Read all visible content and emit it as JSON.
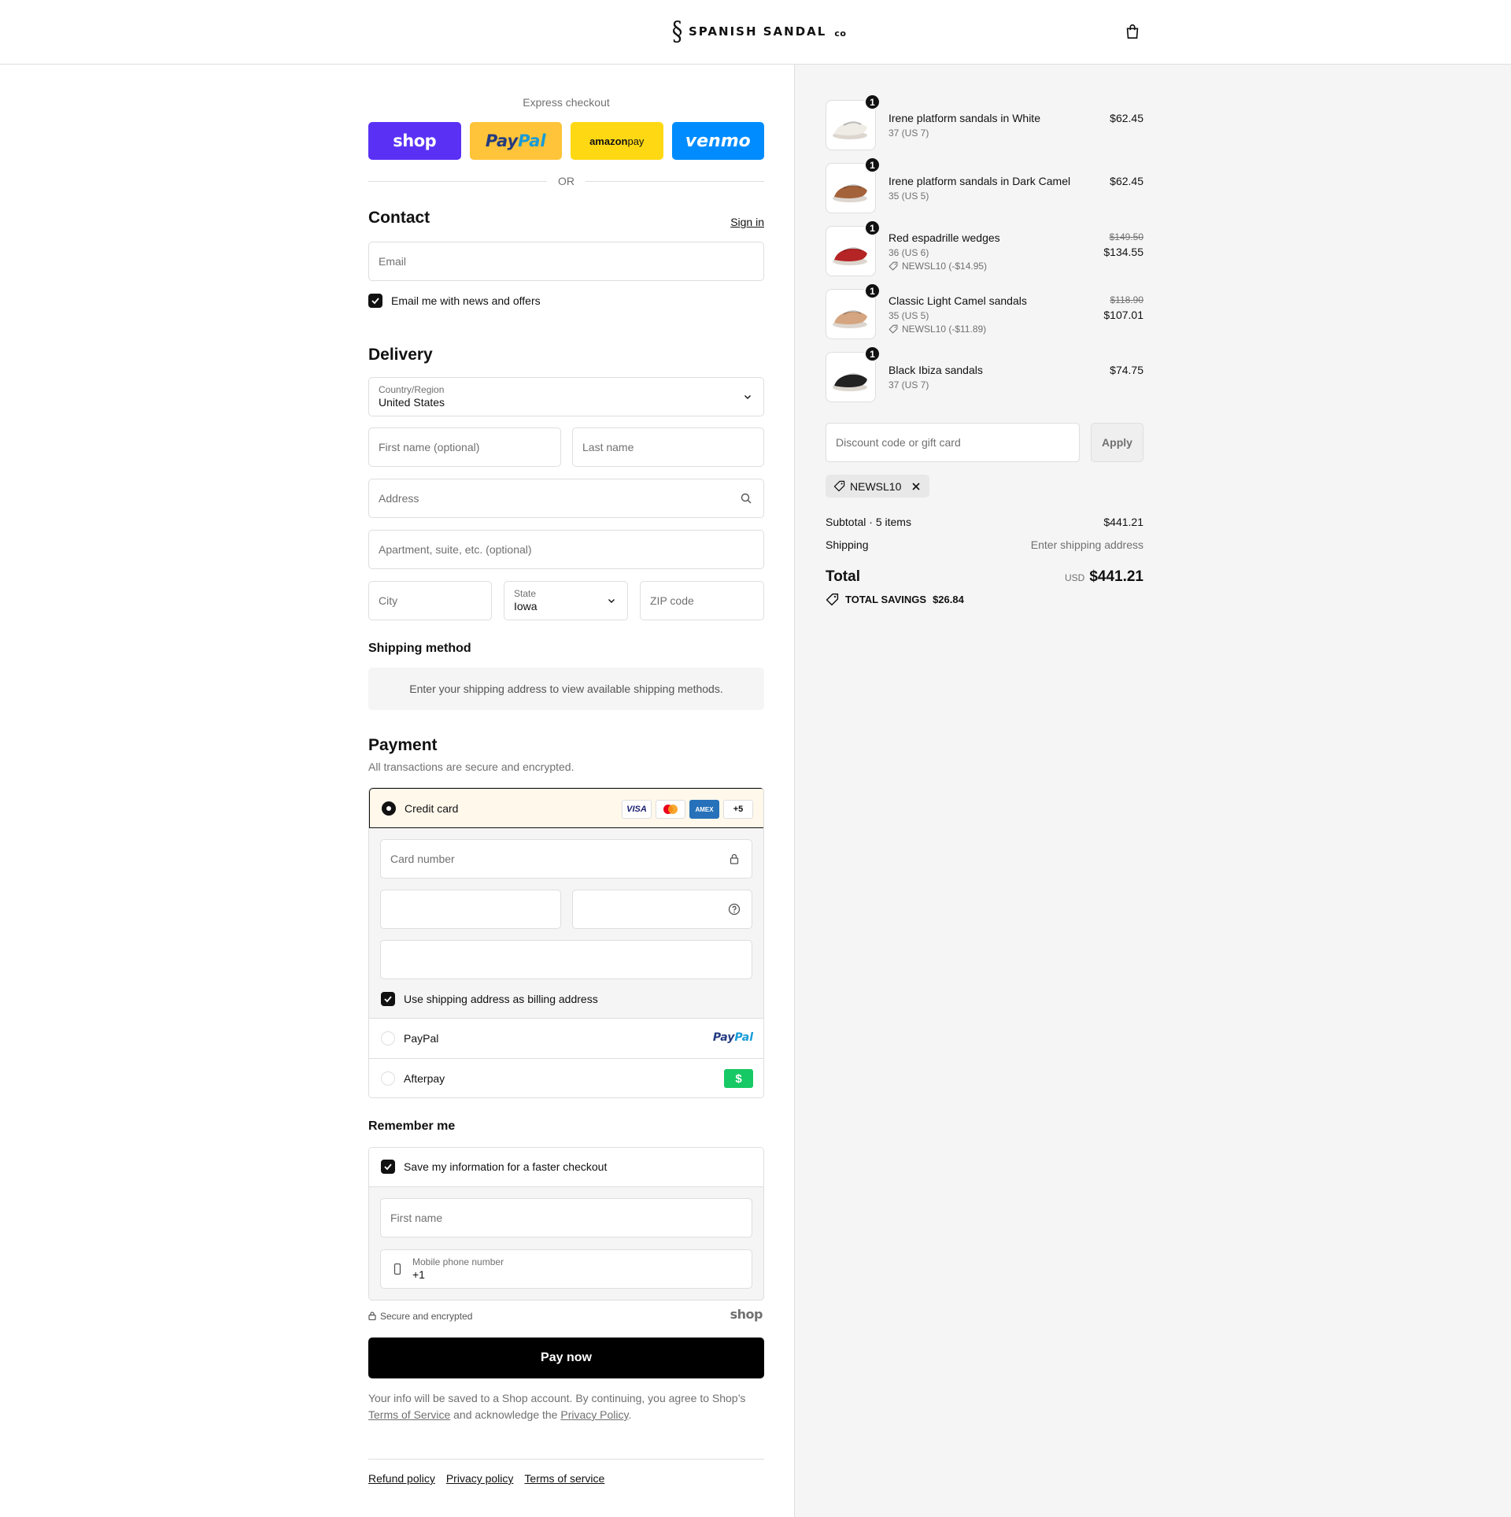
{
  "header": {
    "brand_name": "SPANISH SANDAL",
    "brand_suffix": "co"
  },
  "express": {
    "label": "Express checkout",
    "buttons": {
      "shop": "shop",
      "paypal_part1": "Pay",
      "paypal_part2": "Pal",
      "amazon_part1": "amazon",
      "amazon_part2": " pay",
      "venmo": "venmo"
    },
    "or_label": "OR"
  },
  "contact": {
    "title": "Contact",
    "sign_in": "Sign in",
    "email_placeholder": "Email",
    "news_label": "Email me with news and offers",
    "news_checked": true
  },
  "delivery": {
    "title": "Delivery",
    "country_label": "Country/Region",
    "country_value": "United States",
    "first_name_placeholder": "First name (optional)",
    "last_name_placeholder": "Last name",
    "address_placeholder": "Address",
    "apartment_placeholder": "Apartment, suite, etc. (optional)",
    "city_placeholder": "City",
    "state_label": "State",
    "state_value": "Iowa",
    "zip_placeholder": "ZIP code"
  },
  "shipping_method": {
    "title": "Shipping method",
    "message": "Enter your shipping address to view available shipping methods."
  },
  "payment": {
    "title": "Payment",
    "subtitle": "All transactions are secure and encrypted.",
    "credit_card_label": "Credit card",
    "card_logos": {
      "visa": "VISA",
      "amex": "AMEX",
      "more": "+5"
    },
    "card_number_placeholder": "Card number",
    "billing_label": "Use shipping address as billing address",
    "billing_checked": true,
    "paypal_label": "PayPal",
    "paypal_logo_part1": "Pay",
    "paypal_logo_part2": "Pal",
    "afterpay_label": "Afterpay",
    "afterpay_logo": "$"
  },
  "remember": {
    "title": "Remember me",
    "save_label": "Save my information for a faster checkout",
    "save_checked": true,
    "first_name_placeholder": "First name",
    "phone_label": "Mobile phone number",
    "phone_value": "+1"
  },
  "secure": {
    "label": "Secure and encrypted",
    "shop_logo": "shop"
  },
  "pay_now": "Pay now",
  "legal": {
    "text1": "Your info will be saved to a Shop account. By continuing, you agree to Shop’s ",
    "terms_link": "Terms of Service",
    "text2": " and acknowledge the ",
    "privacy_link": "Privacy Policy",
    "text3": "."
  },
  "footer": {
    "links": [
      "Refund policy",
      "Privacy policy",
      "Terms of service"
    ]
  },
  "summary": {
    "items": [
      {
        "qty": "1",
        "name": "Irene platform sandals in White",
        "variant": "37 (US 7)",
        "price": "$62.45",
        "color": "#efece6"
      },
      {
        "qty": "1",
        "name": "Irene platform sandals in Dark Camel",
        "variant": "35 (US 5)",
        "price": "$62.45",
        "color": "#a4623a"
      },
      {
        "qty": "1",
        "name": "Red espadrille wedges",
        "variant": "36 (US 6)",
        "discount": "NEWSL10 (-$14.95)",
        "original_price": "$149.50",
        "price": "$134.55",
        "color": "#b52525"
      },
      {
        "qty": "1",
        "name": "Classic Light Camel sandals",
        "variant": "35 (US 5)",
        "discount": "NEWSL10 (-$11.89)",
        "original_price": "$118.90",
        "price": "$107.01",
        "color": "#d4a580"
      },
      {
        "qty": "1",
        "name": "Black Ibiza sandals",
        "variant": "37 (US 7)",
        "price": "$74.75",
        "color": "#222222"
      }
    ],
    "discount_placeholder": "Discount code or gift card",
    "apply_label": "Apply",
    "applied_code": "NEWSL10",
    "subtotal_label": "Subtotal · 5 items",
    "subtotal_value": "$441.21",
    "shipping_label": "Shipping",
    "shipping_value": "Enter shipping address",
    "total_label": "Total",
    "currency": "USD",
    "total_value": "$441.21",
    "savings_label": "TOTAL SAVINGS",
    "savings_value": "$26.84"
  },
  "colors": {
    "shop_purple": "#5a31f4",
    "paypal_yellow": "#ffc439",
    "amazon_yellow": "#ffd814",
    "venmo_blue": "#008cff",
    "afterpay_green": "#17c964",
    "selected_payment_bg": "#fff8eb"
  }
}
